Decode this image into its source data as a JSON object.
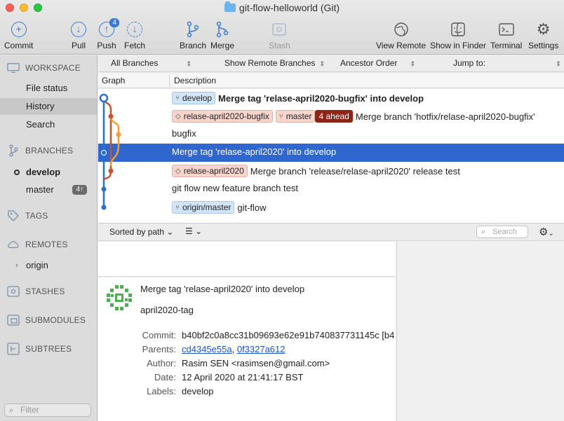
{
  "window": {
    "title": "git-flow-helloworld (Git)"
  },
  "toolbar": {
    "commit": "Commit",
    "pull": "Pull",
    "push": "Push",
    "push_badge": "4",
    "fetch": "Fetch",
    "branch": "Branch",
    "merge": "Merge",
    "stash": "Stash",
    "view_remote": "View Remote",
    "show_in_finder": "Show in Finder",
    "terminal": "Terminal",
    "settings": "Settings"
  },
  "sidebar": {
    "workspace": "WORKSPACE",
    "file_status": "File status",
    "history": "History",
    "search": "Search",
    "branches": "BRANCHES",
    "develop": "develop",
    "master": "master",
    "master_count": "4↑",
    "tags": "TAGS",
    "remotes": "REMOTES",
    "origin": "origin",
    "stashes": "STASHES",
    "submodules": "SUBMODULES",
    "subtrees": "SUBTREES",
    "filter_placeholder": "Filter"
  },
  "filterbar": {
    "branches": "All Branches",
    "remote": "Show Remote Branches",
    "order": "Ancestor Order",
    "jump": "Jump to:"
  },
  "columns": {
    "graph": "Graph",
    "description": "Description"
  },
  "commits": [
    {
      "branch": "develop",
      "message": "Merge tag 'relase-april2020-bugfix' into develop"
    },
    {
      "tag": "relase-april2020-bugfix",
      "branch": "master",
      "ahead": "4 ahead",
      "message": "Merge branch 'hotfix/relase-april2020-bugfix'"
    },
    {
      "message": "bugfix"
    },
    {
      "message": "Merge tag 'relase-april2020' into develop"
    },
    {
      "tag": "relase-april2020",
      "message": "Merge branch 'release/relase-april2020' release test"
    },
    {
      "message": "git flow new feature branch test"
    },
    {
      "branch": "origin/master",
      "message": "git-flow"
    }
  ],
  "bottombar": {
    "sorted": "Sorted by path",
    "search_placeholder": "Search"
  },
  "details": {
    "title": "Merge tag 'relase-april2020' into develop",
    "subtitle": "april2020-tag",
    "commit_label": "Commit:",
    "commit_value": "b40bf2c0a8cc31b09693e62e91b740837731145c [b4",
    "parents_label": "Parents:",
    "parent1": "cd4345e55a",
    "parent2": "0f3327a612",
    "author_label": "Author:",
    "author_value": "Rasim SEN <rasimsen@gmail.com>",
    "date_label": "Date:",
    "date_value": "12 April 2020 at 21:41:17 BST",
    "labels_label": "Labels:",
    "labels_value": "develop"
  },
  "colors": {
    "selection": "#2f67cf",
    "ahead": "#8d2416",
    "graph_blue": "#2a6fc9",
    "graph_red": "#c9502e",
    "graph_orange": "#f0a030"
  }
}
